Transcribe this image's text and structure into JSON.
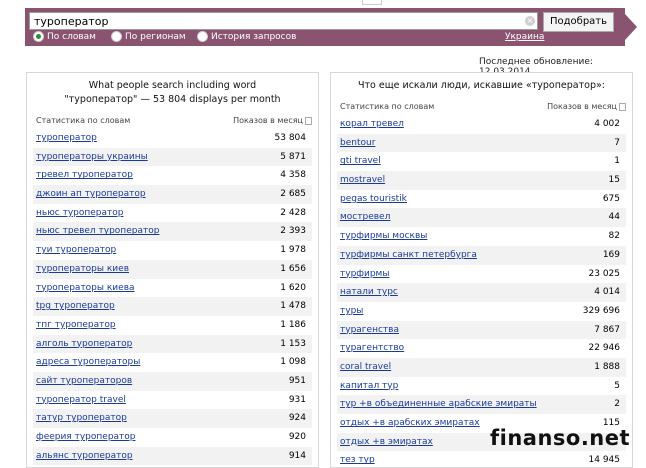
{
  "search": {
    "value": "туроператор",
    "button": "Подобрать",
    "clear_icon": "close-icon"
  },
  "modes": {
    "selected": "По словам",
    "options": [
      "По словам",
      "По регионам",
      "История запросов"
    ]
  },
  "region": "Украина",
  "updated": "Последнее обновление: 12.03.2014",
  "left": {
    "title_line1": "What people search including word",
    "title_line2": "\"туроператор\" — 53 804 displays per month",
    "col1": "Статистика по словам",
    "col2": "Показов в месяц",
    "rows": [
      {
        "q": "туроператор",
        "v": "53 804"
      },
      {
        "q": "туроператоры украины",
        "v": "5 871"
      },
      {
        "q": "тревел туроператор",
        "v": "4 358"
      },
      {
        "q": "джоин ап туроператор",
        "v": "2 685"
      },
      {
        "q": "ньюс туроператор",
        "v": "2 428"
      },
      {
        "q": "ньюс тревел туроператор",
        "v": "2 393"
      },
      {
        "q": "туи туроператор",
        "v": "1 978"
      },
      {
        "q": "туроператоры киев",
        "v": "1 656"
      },
      {
        "q": "туроператоры киева",
        "v": "1 620"
      },
      {
        "q": "tpg туроператор",
        "v": "1 478"
      },
      {
        "q": "тпг туроператор",
        "v": "1 186"
      },
      {
        "q": "алголь туроператор",
        "v": "1 153"
      },
      {
        "q": "адреса туроператоры",
        "v": "1 098"
      },
      {
        "q": "сайт туроператоров",
        "v": "951"
      },
      {
        "q": "туроператор travel",
        "v": "931"
      },
      {
        "q": "татур туроператор",
        "v": "924"
      },
      {
        "q": "феерия туроператор",
        "v": "920"
      },
      {
        "q": "альянс туроператор",
        "v": "914"
      }
    ]
  },
  "right": {
    "title": "Что еще искали люди, искавшие «туроператор»:",
    "col1": "Статистика по словам",
    "col2": "Показов в месяц",
    "rows": [
      {
        "q": "корал тревел",
        "v": "4 002"
      },
      {
        "q": "bentour",
        "v": "7"
      },
      {
        "q": "gti travel",
        "v": "1"
      },
      {
        "q": "mostravel",
        "v": "15"
      },
      {
        "q": "pegas touristik",
        "v": "675"
      },
      {
        "q": "мостревел",
        "v": "44"
      },
      {
        "q": "турфирмы москвы",
        "v": "82"
      },
      {
        "q": "турфирмы санкт петербурга",
        "v": "169"
      },
      {
        "q": "турфирмы",
        "v": "23 025"
      },
      {
        "q": "натали турс",
        "v": "4 014"
      },
      {
        "q": "туры",
        "v": "329 696"
      },
      {
        "q": "турагенства",
        "v": "7 867"
      },
      {
        "q": "турагентство",
        "v": "22 946"
      },
      {
        "q": "coral travel",
        "v": "1 888"
      },
      {
        "q": "капитал тур",
        "v": "5"
      },
      {
        "q": "тур +в объединенные арабские эмираты",
        "v": "2"
      },
      {
        "q": "отдых +в арабских эмиратах",
        "v": "115"
      },
      {
        "q": "отдых +в эмиратах",
        "v": ""
      },
      {
        "q": "тез тур",
        "v": "14 945"
      }
    ]
  },
  "watermark": "finanso.net"
}
